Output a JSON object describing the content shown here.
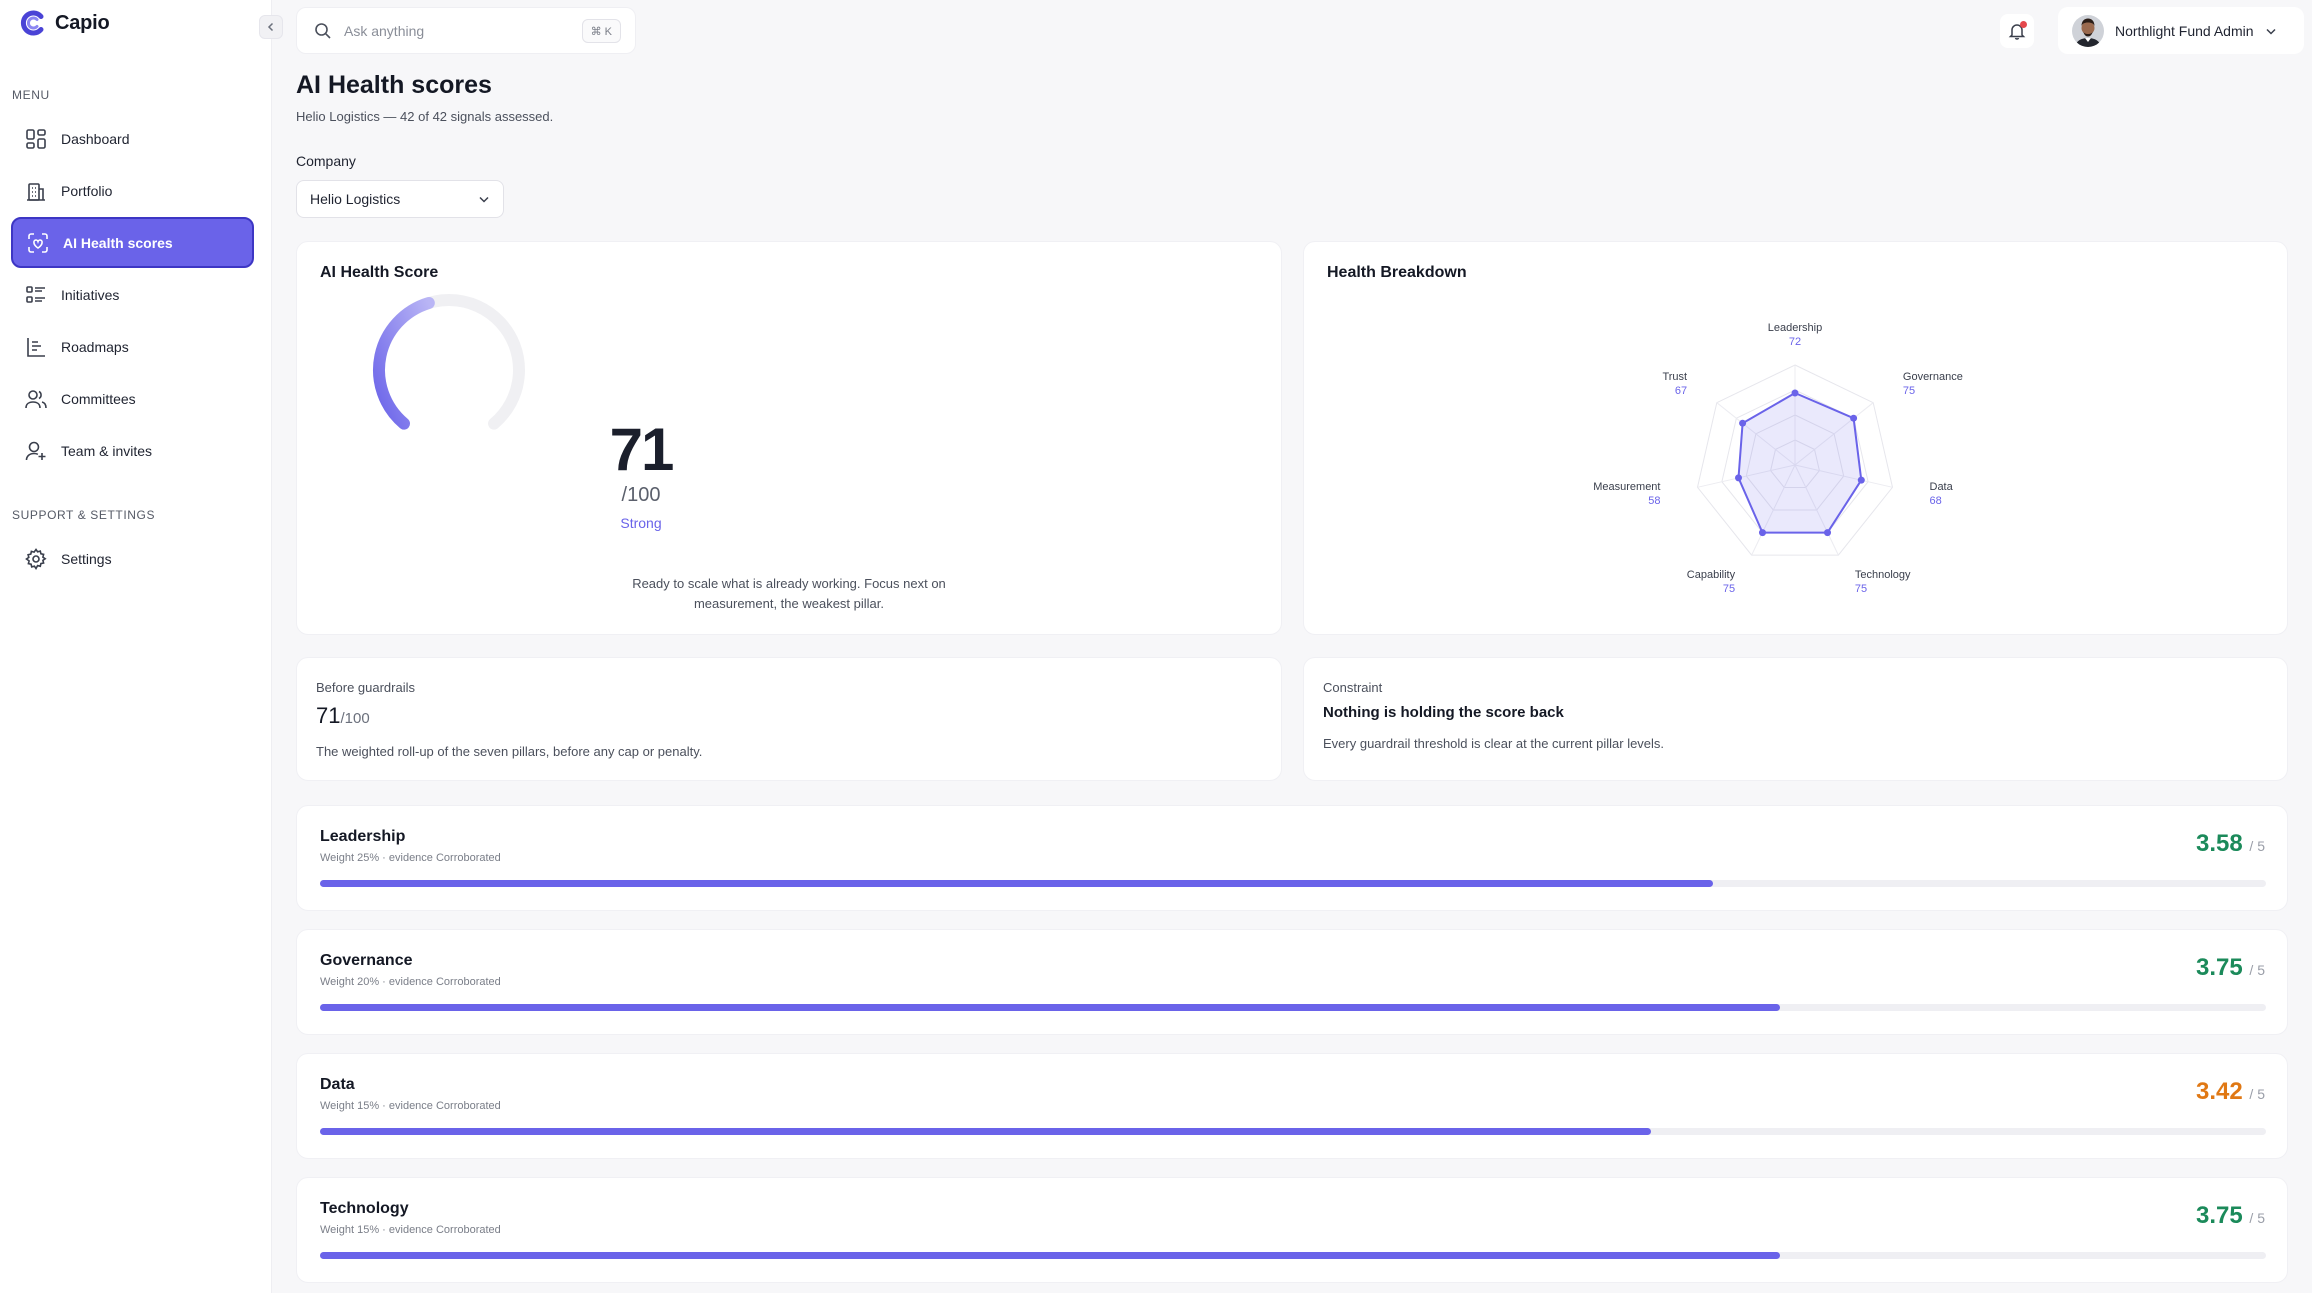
{
  "app": {
    "name": "Capio"
  },
  "sidebar": {
    "menu_label": "MENU",
    "items": [
      {
        "label": "Dashboard",
        "icon": "dashboard-icon"
      },
      {
        "label": "Portfolio",
        "icon": "building-icon"
      },
      {
        "label": "AI Health scores",
        "icon": "heart-scan-icon",
        "active": true
      },
      {
        "label": "Initiatives",
        "icon": "list-icon"
      },
      {
        "label": "Roadmaps",
        "icon": "roadmap-icon"
      },
      {
        "label": "Committees",
        "icon": "users-icon"
      },
      {
        "label": "Team & invites",
        "icon": "user-plus-icon"
      }
    ],
    "support_label": "SUPPORT & SETTINGS",
    "support_items": [
      {
        "label": "Settings",
        "icon": "gear-icon"
      }
    ]
  },
  "search": {
    "placeholder": "Ask anything",
    "shortcut": "⌘ K"
  },
  "user": {
    "name": "Northlight Fund Admin"
  },
  "colors": {
    "accent": "#6a63e9",
    "good": "#1b8a5a",
    "warn": "#e07814",
    "alert": "#e5484d"
  },
  "header": {
    "title": "AI Health scores",
    "subtitle": "Helio Logistics — 42 of 42 signals assessed.",
    "company_label": "Company",
    "company_value": "Helio Logistics"
  },
  "score_card": {
    "title": "AI Health Score",
    "value": "71",
    "max": "/100",
    "fraction": 0.71,
    "label": "Strong",
    "note": "Ready to scale what is already working. Focus next on measurement, the weakest pillar."
  },
  "breakdown": {
    "title": "Health Breakdown",
    "pillars": [
      {
        "name": "Leadership",
        "value": 72
      },
      {
        "name": "Governance",
        "value": 75
      },
      {
        "name": "Data",
        "value": 68
      },
      {
        "name": "Technology",
        "value": 75
      },
      {
        "name": "Capability",
        "value": 75
      },
      {
        "name": "Measurement",
        "value": 58
      },
      {
        "name": "Trust",
        "value": 67
      }
    ]
  },
  "before_guardrails": {
    "label": "Before guardrails",
    "value": "71",
    "max": "/100",
    "text": "The weighted roll-up of the seven pillars, before any cap or penalty."
  },
  "constraint": {
    "label": "Constraint",
    "headline": "Nothing is holding the score back",
    "text": "Every guardrail threshold is clear at the current pillar levels."
  },
  "pillar_rows": [
    {
      "name": "Leadership",
      "meta": "Weight 25% · evidence Corroborated",
      "score": "3.58",
      "of": "/ 5",
      "value": 3.58,
      "color": "#1b8a5a"
    },
    {
      "name": "Governance",
      "meta": "Weight 20% · evidence Corroborated",
      "score": "3.75",
      "of": "/ 5",
      "value": 3.75,
      "color": "#1b8a5a"
    },
    {
      "name": "Data",
      "meta": "Weight 15% · evidence Corroborated",
      "score": "3.42",
      "of": "/ 5",
      "value": 3.42,
      "color": "#e07814"
    },
    {
      "name": "Technology",
      "meta": "Weight 15% · evidence Corroborated",
      "score": "3.75",
      "of": "/ 5",
      "value": 3.75,
      "color": "#1b8a5a"
    }
  ]
}
